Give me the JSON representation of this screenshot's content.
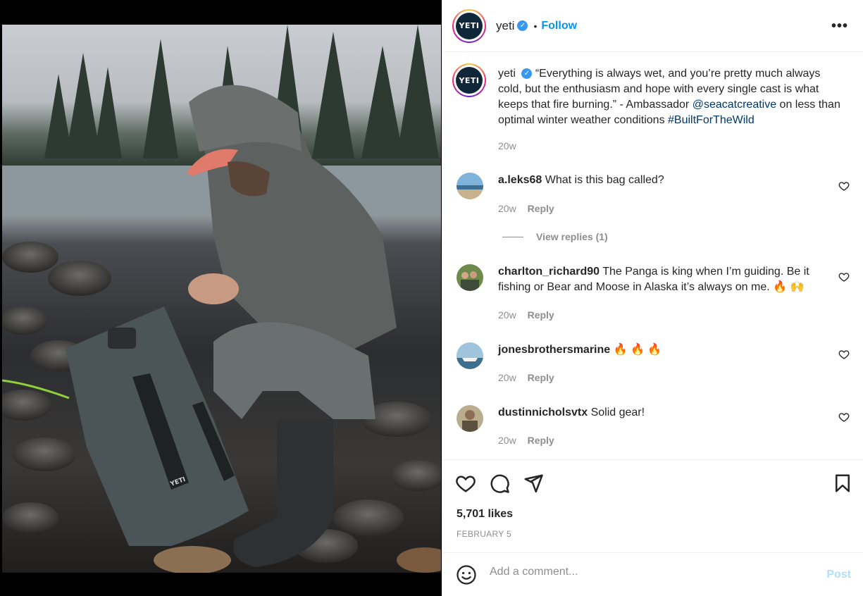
{
  "post": {
    "author": "yeti",
    "avatar_text": "YETI",
    "verified_mark": "✓",
    "separator": "•",
    "follow_label": "Follow",
    "more_label": "•••",
    "caption_text_1": "“Everything is always wet, and you’re pretty much always cold, but the enthusiasm and hope with every single cast is what keeps that fire burning.” - Ambassador ",
    "caption_mention": "@seacatcreative",
    "caption_text_2": " on less than optimal winter weather conditions ",
    "caption_hashtag": "#BuiltForTheWild",
    "caption_time": "20w",
    "photo_alt": "YETI",
    "likes": "5,701 likes",
    "date": "FEBRUARY 5"
  },
  "comments": [
    {
      "user": "a.leks68",
      "text": "What is this bag called?",
      "time": "20w",
      "reply_label": "Reply",
      "view_replies": "View replies (1)",
      "avatar_icon": "beach-photo"
    },
    {
      "user": "charlton_richard90",
      "text": "The Panga is king when I’m guiding. Be it fishing or Bear and Moose in Alaska it’s always on me. 🔥 🙌",
      "time": "20w",
      "reply_label": "Reply",
      "avatar_icon": "group-photo"
    },
    {
      "user": "jonesbrothersmarine",
      "text": "🔥 🔥 🔥",
      "time": "20w",
      "reply_label": "Reply",
      "avatar_icon": "boat-photo"
    },
    {
      "user": "dustinnicholsvtx",
      "text": "Solid gear!",
      "time": "20w",
      "reply_label": "Reply",
      "avatar_icon": "portrait-photo"
    }
  ],
  "composer": {
    "placeholder": "Add a comment...",
    "post_label": "Post"
  },
  "colors": {
    "accent": "#0095f6",
    "link": "#00376b",
    "muted": "#8e8e8e",
    "post_disabled": "#b2dffc",
    "brand": "#10273a"
  },
  "icons": {
    "like": "heart-icon",
    "comment": "comment-bubble-icon",
    "share": "paper-plane-icon",
    "save": "bookmark-icon",
    "emoji": "smiley-icon",
    "more": "more-options-icon",
    "verified": "verified-badge-icon"
  }
}
